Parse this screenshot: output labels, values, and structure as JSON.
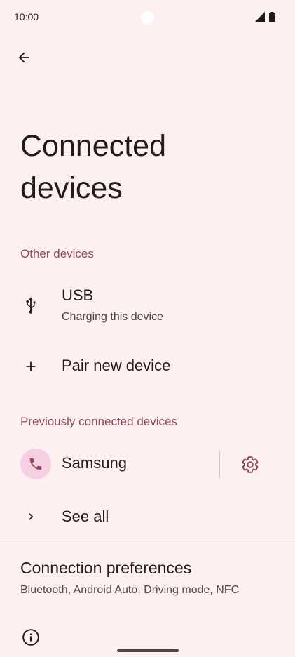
{
  "status_bar": {
    "time": "10:00",
    "icons": [
      "signal-icon",
      "battery-icon"
    ]
  },
  "header": {
    "back_icon": "arrow-back-icon",
    "title": "Connected\ndevices"
  },
  "sections": {
    "other_devices": {
      "label": "Other devices",
      "items": [
        {
          "icon": "usb-icon",
          "title": "USB",
          "subtitle": "Charging this device"
        },
        {
          "icon": "plus-icon",
          "title": "Pair new device"
        }
      ]
    },
    "previously_connected": {
      "label": "Previously connected devices",
      "device": {
        "icon": "phone-icon",
        "title": "Samsung",
        "settings_icon": "gear-icon"
      },
      "see_all": {
        "icon": "chevron-right-icon",
        "title": "See all"
      }
    }
  },
  "preferences": {
    "title": "Connection preferences",
    "subtitle": "Bluetooth, Android Auto, Driving mode, NFC"
  },
  "footer": {
    "info_icon": "info-icon"
  },
  "colors": {
    "background": "#fcf0f1",
    "accent": "#8f4a54",
    "avatar_bg": "#f6cfe2",
    "text_primary": "#221a1c",
    "text_secondary": "#534346"
  }
}
